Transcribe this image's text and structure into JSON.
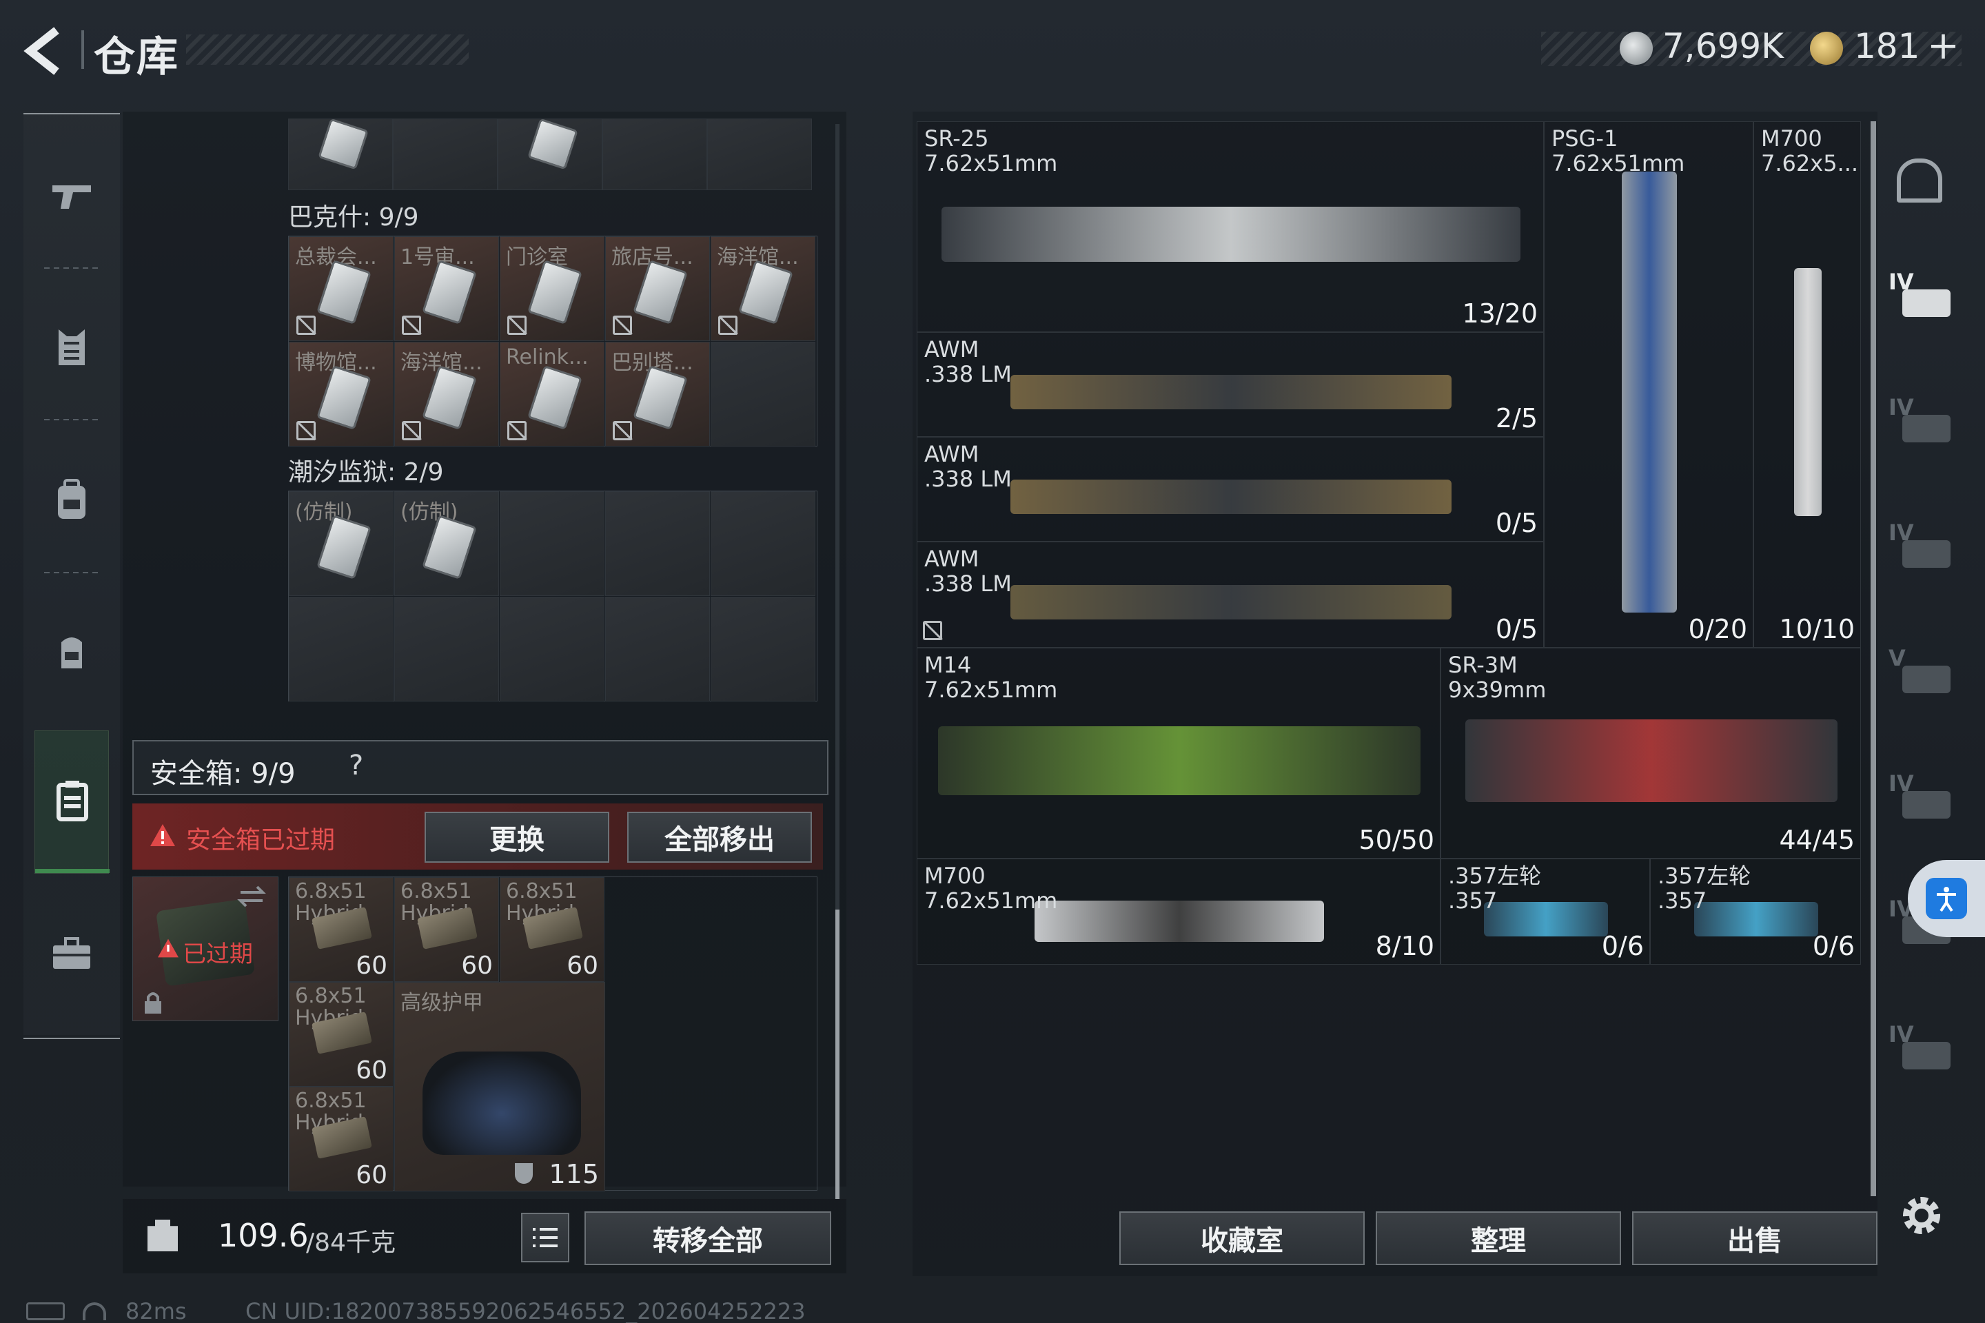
{
  "header": {
    "title": "仓库",
    "currency1": "7,699K",
    "currency2": "181",
    "plus": "+"
  },
  "nav": {
    "items": [
      "weapons",
      "armor",
      "backpack",
      "rig",
      "secure-case",
      "toolbox"
    ]
  },
  "storage": {
    "section1": {
      "title": "巴克什: 9/9",
      "items": [
        {
          "label": "总裁会...",
          "tint": "red"
        },
        {
          "label": "1号审...",
          "tint": "red"
        },
        {
          "label": "门诊室",
          "tint": "red"
        },
        {
          "label": "旅店号...",
          "tint": "red"
        },
        {
          "label": "海洋馆...",
          "tint": "red"
        },
        {
          "label": "博物馆...",
          "tint": "red"
        },
        {
          "label": "海洋馆...",
          "tint": "red"
        },
        {
          "label": "Relink...",
          "tint": "red"
        },
        {
          "label": "巴别塔...",
          "tint": "red"
        }
      ]
    },
    "section2": {
      "title": "潮汐监狱: 2/9",
      "items": [
        {
          "label": "(仿制)"
        },
        {
          "label": "(仿制)"
        }
      ]
    }
  },
  "safebox": {
    "title": "安全箱: 9/9",
    "help": "?",
    "warning": "安全箱已过期",
    "replace": "更换",
    "remove_all": "全部移出",
    "expired": "已过期",
    "items": [
      {
        "label": "6.8x51 Hybrid",
        "count": "60"
      },
      {
        "label": "6.8x51 Hybrid",
        "count": "60"
      },
      {
        "label": "6.8x51 Hybrid",
        "count": "60"
      },
      {
        "label": "6.8x51 Hybrid",
        "count": "60"
      },
      {
        "label": "6.8x51 Hybrid",
        "count": "60"
      }
    ],
    "armor": {
      "label": "高级护甲",
      "value": "115"
    }
  },
  "footer": {
    "weight": "109.6",
    "weight_max": "/84千克",
    "transfer_all": "转移全部"
  },
  "weapons": [
    {
      "name": "SR-25",
      "ammo": "7.62x51mm",
      "count": "13/20"
    },
    {
      "name": "PSG-1",
      "ammo": "7.62x51mm",
      "count": "0/20"
    },
    {
      "name": "M700",
      "ammo": "7.62x5...",
      "count": "10/10"
    },
    {
      "name": "AWM",
      "ammo": ".338 LM",
      "count": "2/5"
    },
    {
      "name": "AWM",
      "ammo": ".338 LM",
      "count": "0/5"
    },
    {
      "name": "AWM",
      "ammo": ".338 LM",
      "count": "0/5"
    },
    {
      "name": "M14",
      "ammo": "7.62x51mm",
      "count": "50/50"
    },
    {
      "name": "SR-3M",
      "ammo": "9x39mm",
      "count": "44/45"
    },
    {
      "name": "M700",
      "ammo": "7.62x51mm",
      "count": "8/10"
    },
    {
      "name": ".357左轮",
      "ammo": ".357",
      "count": "0/6"
    },
    {
      "name": ".357左轮",
      "ammo": ".357",
      "count": "0/6"
    }
  ],
  "right_tabs": [
    "IV",
    "IV",
    "IV",
    "V",
    "IV",
    "IV",
    "IV"
  ],
  "actions": {
    "collection": "收藏室",
    "sort": "整理",
    "sell": "出售"
  },
  "status": {
    "ping": "82ms",
    "uid": "CN UID:182007385592062546552_202604252223"
  },
  "colors": {
    "accent_green": "#3f8a4f",
    "warning_red": "#e04848",
    "coin_gold": "#c9a85a"
  }
}
